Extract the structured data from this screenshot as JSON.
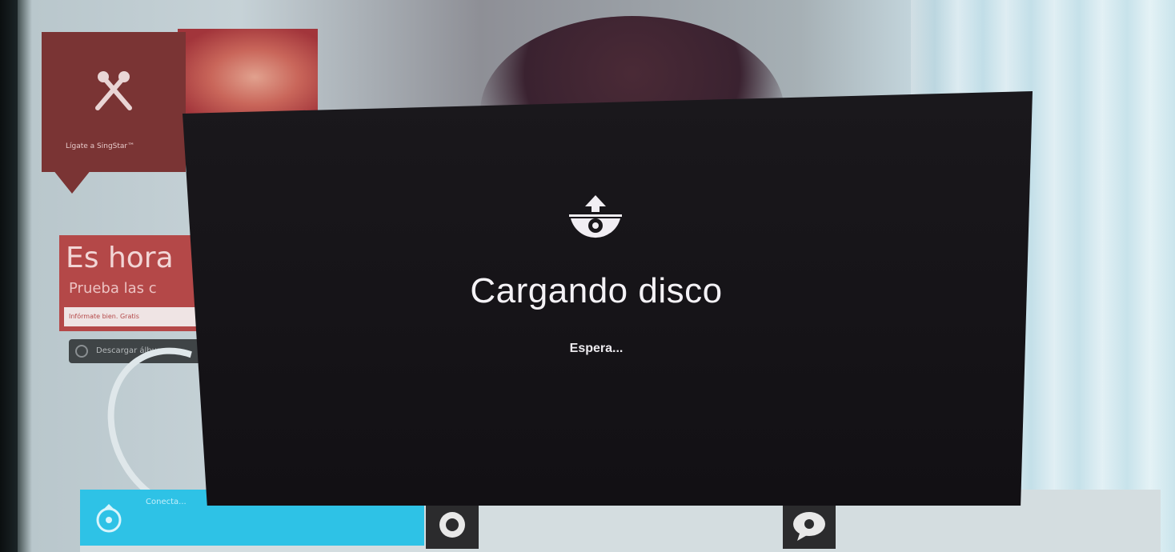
{
  "background": {
    "sing_tile": {
      "label": "Lígate a SingStar™",
      "icon": "microphone-icon"
    },
    "promo_tile": {
      "headline": "Es hora",
      "subline": "Prueba las c",
      "strip_text": "Infórmate bien. Gratis"
    },
    "download_pill": {
      "label": "Descargar álbum",
      "icon": "circle-icon"
    },
    "bottom_bar": {
      "cyan_label": "Conecta...",
      "cyan_icon": "download-disc-icon",
      "buttons": [
        {
          "icon": "disc-icon"
        },
        {
          "icon": "speech-bubble-icon"
        }
      ]
    }
  },
  "dialog": {
    "icon": "disc-load-icon",
    "title": "Cargando disco",
    "subtitle": "Espera..."
  },
  "colors": {
    "dialog_bg": "#151317",
    "sing_tile": "#7a3434",
    "promo_tile": "#b44848",
    "cyan_tile": "#2ec2e6",
    "text_light": "#f4f2f6"
  }
}
